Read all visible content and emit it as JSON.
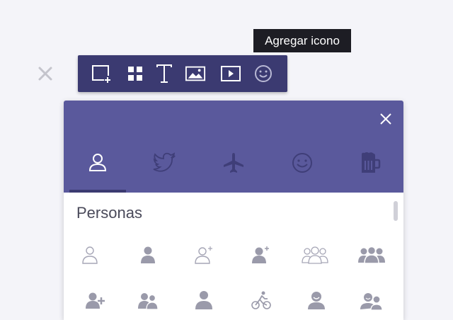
{
  "tooltip": {
    "text": "Agregar icono"
  },
  "toolbar": {
    "buttons": [
      {
        "name": "add-frame",
        "icon": "add-frame-icon"
      },
      {
        "name": "grid",
        "icon": "grid-icon"
      },
      {
        "name": "text",
        "icon": "text-icon"
      },
      {
        "name": "image",
        "icon": "image-icon"
      },
      {
        "name": "video",
        "icon": "video-icon"
      },
      {
        "name": "icon",
        "icon": "smiley-icon"
      }
    ]
  },
  "panel": {
    "categories": [
      {
        "name": "personas",
        "icon": "person-icon",
        "active": true
      },
      {
        "name": "social",
        "icon": "twitter-bird-icon",
        "active": false
      },
      {
        "name": "travel",
        "icon": "airplane-icon",
        "active": false
      },
      {
        "name": "emoji",
        "icon": "smiley-icon",
        "active": false
      },
      {
        "name": "food",
        "icon": "beer-mug-icon",
        "active": false
      }
    ],
    "section_title": "Personas",
    "icons_row1": [
      "person-outline-icon",
      "person-solid-icon",
      "person-add-outline-icon",
      "person-add-solid-icon",
      "group-outline-icon",
      "group-solid-icon"
    ],
    "icons_row2": [
      "person-plus-icon",
      "couple-icon",
      "user-icon",
      "cyclist-icon",
      "user-smile-icon",
      "users-chat-icon"
    ]
  },
  "colors": {
    "background": "#f4f4f9",
    "toolbar": "#3b3a71",
    "panel_header": "#5a599c",
    "tooltip": "#1d1d24",
    "icon_gray": "#9a9aaa"
  }
}
